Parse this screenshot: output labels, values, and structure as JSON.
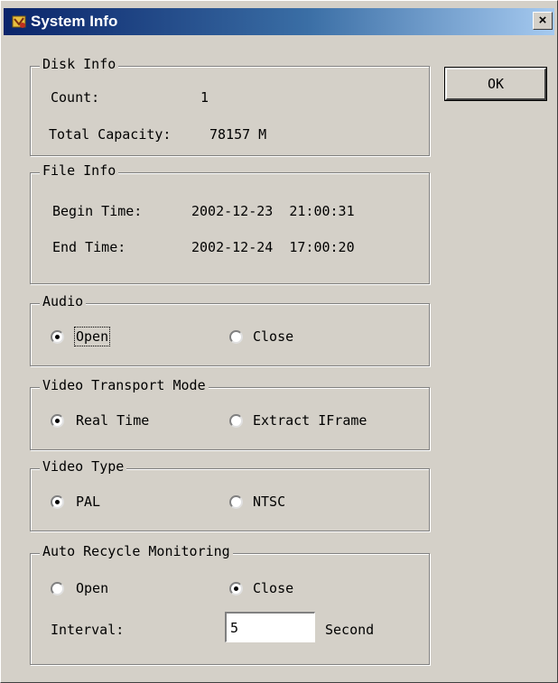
{
  "window": {
    "title": "System Info",
    "close_label": "×"
  },
  "ok_label": "OK",
  "disk_info": {
    "legend": "Disk Info",
    "count_label": "Count:",
    "count_value": "1",
    "capacity_label": "Total Capacity:",
    "capacity_value": "78157 M"
  },
  "file_info": {
    "legend": "File Info",
    "begin_label": "Begin Time:",
    "begin_value": "2002-12-23  21:00:31",
    "end_label": "End Time:",
    "end_value": "2002-12-24  17:00:20"
  },
  "audio": {
    "legend": "Audio",
    "options": [
      {
        "label": "Open",
        "selected": true
      },
      {
        "label": "Close",
        "selected": false
      }
    ]
  },
  "transport": {
    "legend": "Video Transport Mode",
    "options": [
      {
        "label": "Real Time",
        "selected": true
      },
      {
        "label": "Extract IFrame",
        "selected": false
      }
    ]
  },
  "video_type": {
    "legend": "Video Type",
    "options": [
      {
        "label": "PAL",
        "selected": true
      },
      {
        "label": "NTSC",
        "selected": false
      }
    ]
  },
  "recycle": {
    "legend": "Auto Recycle Monitoring",
    "options": [
      {
        "label": "Open",
        "selected": false
      },
      {
        "label": "Close",
        "selected": true
      }
    ],
    "interval_label": "Interval:",
    "interval_value": "5",
    "unit_label": "Second"
  },
  "colors": {
    "titlebar_start": "#0a246a",
    "titlebar_end": "#a6caf0",
    "face": "#d4d0c8"
  },
  "icons": {
    "title": "app-icon"
  }
}
